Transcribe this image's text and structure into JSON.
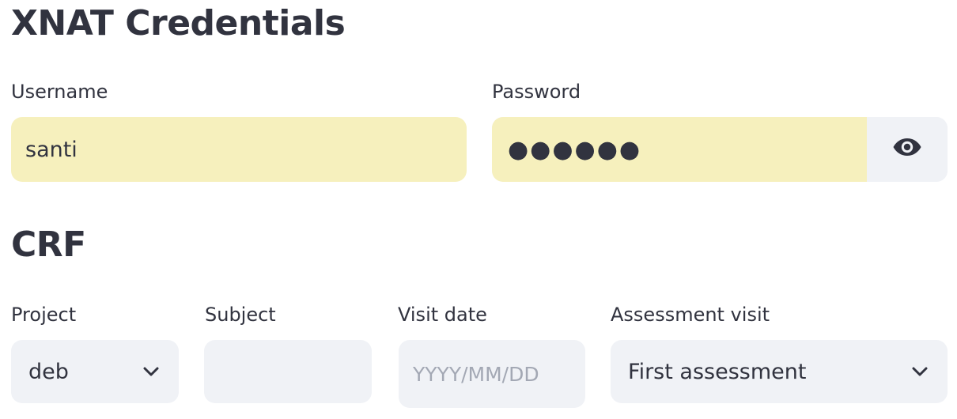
{
  "credentials": {
    "title": "XNAT Credentials",
    "username_label": "Username",
    "username_value": "santi",
    "password_label": "Password",
    "password_masked": "●●●●●●",
    "toggle_icon": "eye-icon"
  },
  "crf": {
    "title": "CRF",
    "project_label": "Project",
    "project_value": "deb",
    "subject_label": "Subject",
    "subject_value": "",
    "visit_date_label": "Visit date",
    "visit_date_placeholder": "YYYY/MM/DD",
    "assessment_label": "Assessment visit",
    "assessment_value": "First assessment"
  },
  "colors": {
    "autofill_bg": "#f6f0bd",
    "input_bg": "#f0f2f6",
    "text": "#31333f",
    "placeholder": "#a3a8b4"
  }
}
